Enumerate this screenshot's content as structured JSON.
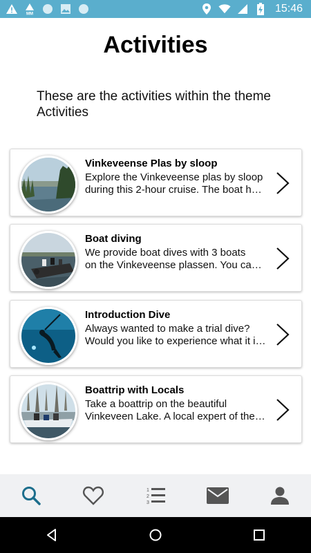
{
  "status_bar": {
    "time": "15:46",
    "left_icons": [
      "warning-icon",
      "mm-warning-icon",
      "circle-icon",
      "image-icon",
      "circle-icon"
    ],
    "right_icons": [
      "location-icon",
      "wifi-icon",
      "signal-icon",
      "battery-icon"
    ]
  },
  "page": {
    "title": "Activities",
    "intro": "These are the activities within the theme Activities"
  },
  "activities": [
    {
      "title": "Vinkeveense Plas by sloop",
      "desc_line1": "Explore the Vinkeveense plas by sloop",
      "desc_line2": "during this 2-hour cruise. The boat h…",
      "image": "lake-landscape"
    },
    {
      "title": "Boat diving",
      "desc_line1": "We provide boat dives with 3 boats",
      "desc_line2": "on the Vinkeveense plassen. You can…",
      "image": "dive-boat"
    },
    {
      "title": "Introduction Dive",
      "desc_line1": "Always wanted to make a trial dive?",
      "desc_line2": "Would you like to experience what it i…",
      "image": "underwater-diver"
    },
    {
      "title": "Boattrip with Locals",
      "desc_line1": "Take a boattrip on the beautiful",
      "desc_line2": "Vinkeveen Lake. A local expert of the…",
      "image": "people-on-boat"
    }
  ],
  "bottom_nav": {
    "items": [
      "search-icon",
      "heart-icon",
      "numbered-list-icon",
      "mail-icon",
      "person-icon"
    ],
    "active": "search-icon"
  },
  "system_nav": [
    "back-icon",
    "home-icon",
    "recents-icon"
  ],
  "colors": {
    "status_bar": "#5aaecd",
    "nav_active": "#1c6e8c",
    "nav_inactive": "#555555",
    "nav_background": "#f0f1f3"
  }
}
